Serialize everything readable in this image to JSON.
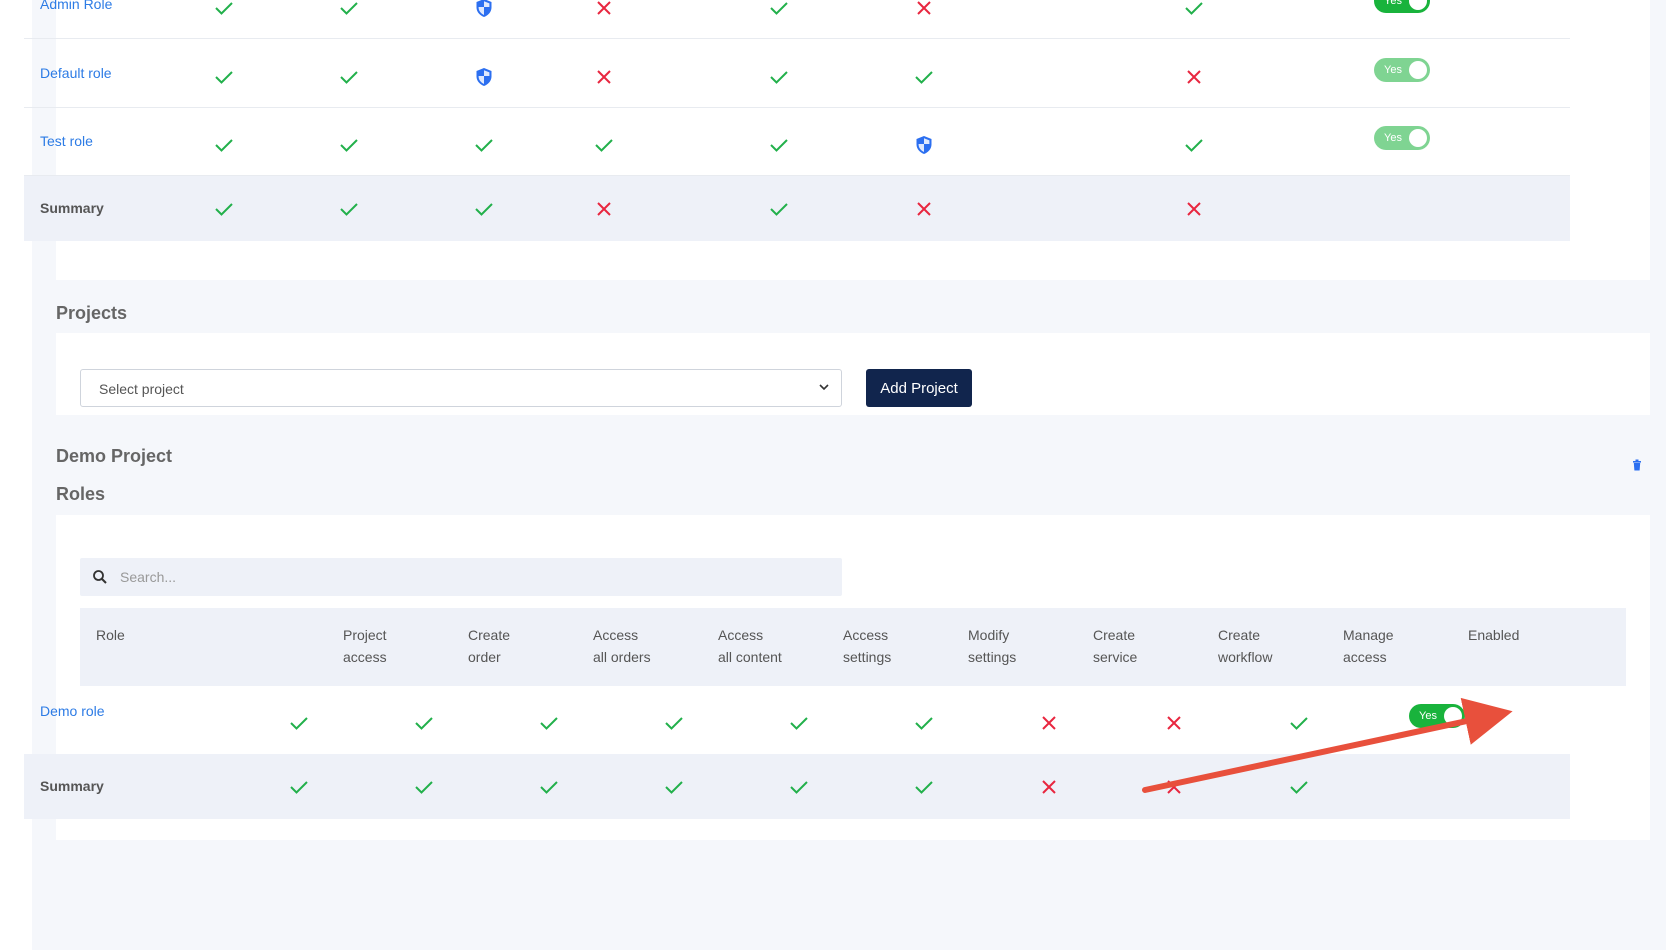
{
  "top_table": {
    "rows": [
      {
        "name": "Admin Role",
        "cells": [
          "check",
          "check",
          "shield",
          "x",
          "check",
          "x",
          "check"
        ],
        "enabled": "Yes"
      },
      {
        "name": "Default role",
        "cells": [
          "check",
          "check",
          "shield",
          "x",
          "check",
          "check",
          "x"
        ],
        "enabled": "Yes"
      },
      {
        "name": "Test role",
        "cells": [
          "check",
          "check",
          "check",
          "check",
          "check",
          "shield",
          "check"
        ],
        "enabled": "Yes"
      }
    ],
    "summary": {
      "label": "Summary",
      "cells": [
        "check",
        "check",
        "check",
        "x",
        "check",
        "x",
        "x"
      ]
    }
  },
  "projects": {
    "heading": "Projects",
    "select_placeholder": "Select project",
    "add_button": "Add Project"
  },
  "demo_project": {
    "title": "Demo Project",
    "roles_heading": "Roles",
    "search_placeholder": "Search...",
    "headers": [
      {
        "l1": "Role",
        "l2": ""
      },
      {
        "l1": "Project",
        "l2": "access"
      },
      {
        "l1": "Create",
        "l2": "order"
      },
      {
        "l1": "Access",
        "l2": "all orders"
      },
      {
        "l1": "Access",
        "l2": "all content"
      },
      {
        "l1": "Access",
        "l2": "settings"
      },
      {
        "l1": "Modify",
        "l2": "settings"
      },
      {
        "l1": "Create",
        "l2": "service"
      },
      {
        "l1": "Create",
        "l2": "workflow"
      },
      {
        "l1": "Manage",
        "l2": "access"
      },
      {
        "l1": "Enabled",
        "l2": ""
      }
    ],
    "rows": [
      {
        "name": "Demo role",
        "cells": [
          "check",
          "check",
          "check",
          "check",
          "check",
          "check",
          "x",
          "x",
          "check"
        ],
        "enabled": "Yes"
      }
    ],
    "summary": {
      "label": "Summary",
      "cells": [
        "check",
        "check",
        "check",
        "check",
        "check",
        "check",
        "x",
        "x",
        "check"
      ]
    }
  },
  "colors": {
    "check": "#22b04b",
    "x": "#e8263f",
    "shield": "#2c6ff0",
    "annotation_arrow": "#e8503c",
    "button": "#11254d"
  },
  "icons": [
    "check-icon",
    "x-icon",
    "shield-icon",
    "search-icon",
    "chevron-down-icon",
    "trash-icon"
  ]
}
